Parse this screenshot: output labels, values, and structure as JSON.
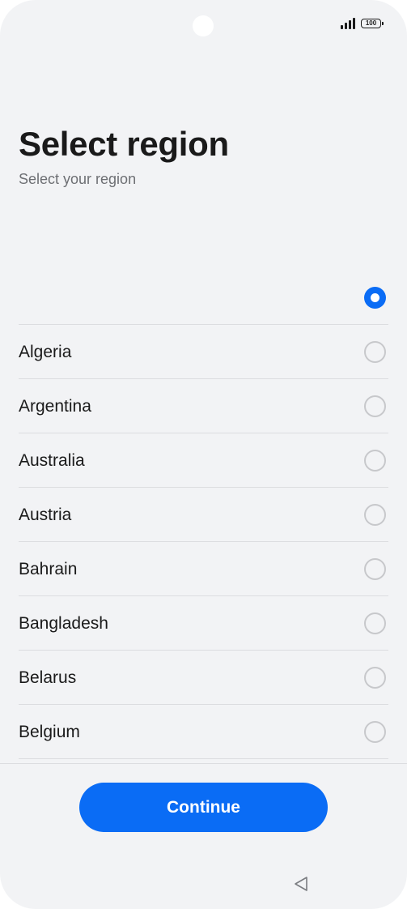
{
  "status_bar": {
    "battery_level": "100",
    "signal_icon": "signal-icon",
    "battery_icon": "battery-icon"
  },
  "header": {
    "title": "Select region",
    "subtitle": "Select your region"
  },
  "regions": [
    {
      "label": "",
      "selected": true
    },
    {
      "label": "Algeria",
      "selected": false
    },
    {
      "label": "Argentina",
      "selected": false
    },
    {
      "label": "Australia",
      "selected": false
    },
    {
      "label": "Austria",
      "selected": false
    },
    {
      "label": "Bahrain",
      "selected": false
    },
    {
      "label": "Bangladesh",
      "selected": false
    },
    {
      "label": "Belarus",
      "selected": false
    },
    {
      "label": "Belgium",
      "selected": false
    }
  ],
  "footer": {
    "continue_label": "Continue"
  },
  "nav_bar": {
    "back_icon": "back-triangle-icon"
  },
  "colors": {
    "accent": "#0a6cf5",
    "background": "#f2f3f5",
    "divider": "#dcdde0",
    "subtitle": "#6d6f73"
  }
}
